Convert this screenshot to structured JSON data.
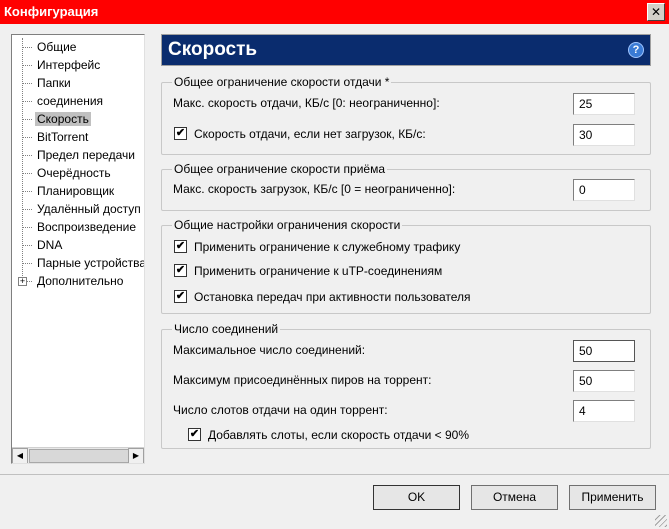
{
  "window": {
    "title": "Конфигурация",
    "close_icon": "close-icon"
  },
  "sidebar": {
    "items": [
      {
        "label": "Общие"
      },
      {
        "label": "Интерфейс"
      },
      {
        "label": "Папки"
      },
      {
        "label": "соединения"
      },
      {
        "label": "Скорость"
      },
      {
        "label": "BitTorrent"
      },
      {
        "label": "Предел передачи"
      },
      {
        "label": "Очерёдность"
      },
      {
        "label": "Планировщик"
      },
      {
        "label": "Удалённый доступ"
      },
      {
        "label": "Воспроизведение"
      },
      {
        "label": "DNA"
      },
      {
        "label": "Парные устройства"
      },
      {
        "label": "Дополнительно"
      }
    ],
    "selected": "Скорость"
  },
  "header": {
    "title": "Скорость",
    "help_icon": "?"
  },
  "upload_group": {
    "legend": "Общее ограничение скорости отдачи *",
    "max_upload_label": "Макс. скорость отдачи, КБ/с [0: неограниченно]:",
    "max_upload_value": "25",
    "no_download_checked": true,
    "no_download_label": "Скорость отдачи, если нет загрузок, КБ/с:",
    "no_download_value": "30"
  },
  "download_group": {
    "legend": "Общее ограничение скорости приёма",
    "max_download_label": "Макс. скорость загрузок, КБ/с [0 = неограниченно]:",
    "max_download_value": "0"
  },
  "general_group": {
    "legend": "Общие настройки ограничения скорости",
    "overhead_label": "Применить ограничение к служебному трафику",
    "overhead_checked": true,
    "utp_label": "Применить ограничение к uTP-соединениям",
    "utp_checked": true,
    "user_activity_label": "Остановка передач при активности пользователя",
    "user_activity_checked": true
  },
  "connections_group": {
    "legend": "Число соединений",
    "max_conn_label": "Максимальное число соединений:",
    "max_conn_value": "50",
    "max_peers_label": "Максимум присоединённых пиров на торрент:",
    "max_peers_value": "50",
    "upload_slots_label": "Число слотов отдачи на один торрент:",
    "upload_slots_value": "4",
    "extra_slots_label": "Добавлять слоты, если скорость отдачи < 90%",
    "extra_slots_checked": true
  },
  "buttons": {
    "ok": "OK",
    "cancel": "Отмена",
    "apply": "Применить"
  },
  "check_mark": "✔",
  "colors": {
    "titlebar": "#ff0000",
    "header": "#0a2c6e"
  }
}
